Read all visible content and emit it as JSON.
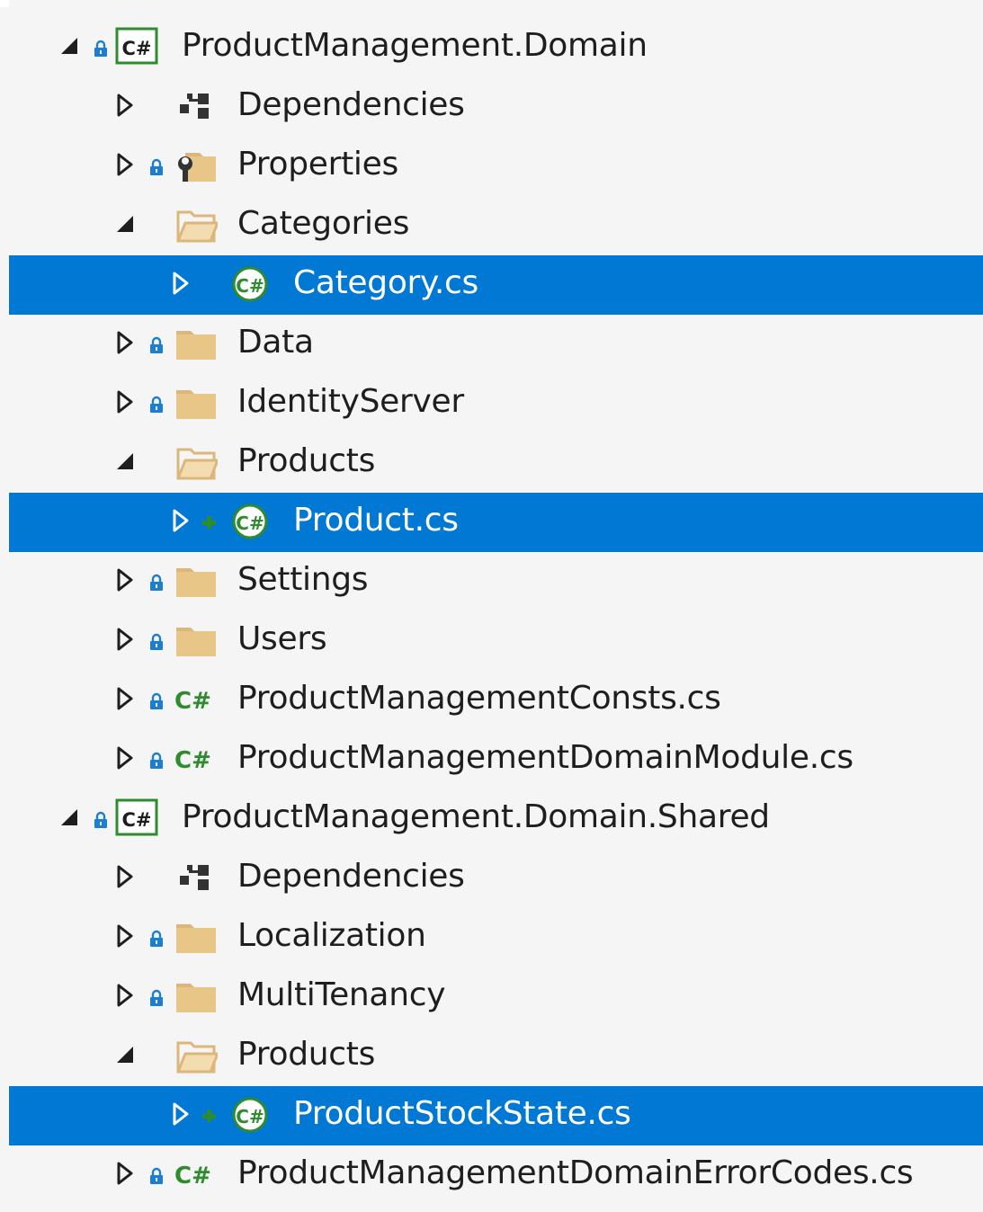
{
  "colors": {
    "background": "#f5f5f5",
    "selection": "#0078d4",
    "lock": "#1a7fd4",
    "csharp_green": "#2e8b2e",
    "folder": "#dcb67a"
  },
  "tree": [
    {
      "label": "ProductManagement.Domain",
      "level": 0,
      "expander": "expanded",
      "lock": true,
      "icon": "csharp-project-icon"
    },
    {
      "label": "Dependencies",
      "level": 1,
      "expander": "collapsed",
      "lock": false,
      "icon": "dependencies-icon"
    },
    {
      "label": "Properties",
      "level": 1,
      "expander": "collapsed",
      "lock": true,
      "icon": "properties-folder-icon"
    },
    {
      "label": "Categories",
      "level": 1,
      "expander": "expanded",
      "lock": false,
      "icon": "open-folder-icon"
    },
    {
      "label": "Category.cs",
      "level": 2,
      "expander": "collapsed",
      "lock": false,
      "plus": false,
      "icon": "csharp-class-icon",
      "selected": true
    },
    {
      "label": "Data",
      "level": 1,
      "expander": "collapsed",
      "lock": true,
      "icon": "folder-icon"
    },
    {
      "label": "IdentityServer",
      "level": 1,
      "expander": "collapsed",
      "lock": true,
      "icon": "folder-icon"
    },
    {
      "label": "Products",
      "level": 1,
      "expander": "expanded",
      "lock": false,
      "icon": "open-folder-icon"
    },
    {
      "label": "Product.cs",
      "level": 2,
      "expander": "collapsed",
      "lock": false,
      "plus": true,
      "icon": "csharp-class-icon",
      "selected": true
    },
    {
      "label": "Settings",
      "level": 1,
      "expander": "collapsed",
      "lock": true,
      "icon": "folder-icon"
    },
    {
      "label": "Users",
      "level": 1,
      "expander": "collapsed",
      "lock": true,
      "icon": "folder-icon"
    },
    {
      "label": "ProductManagementConsts.cs",
      "level": 1,
      "expander": "collapsed",
      "lock": true,
      "icon": "csharp-file-icon"
    },
    {
      "label": "ProductManagementDomainModule.cs",
      "level": 1,
      "expander": "collapsed",
      "lock": true,
      "icon": "csharp-file-icon"
    },
    {
      "label": "ProductManagement.Domain.Shared",
      "level": 0,
      "expander": "expanded",
      "lock": true,
      "icon": "csharp-project-icon"
    },
    {
      "label": "Dependencies",
      "level": 1,
      "expander": "collapsed",
      "lock": false,
      "icon": "dependencies-icon"
    },
    {
      "label": "Localization",
      "level": 1,
      "expander": "collapsed",
      "lock": true,
      "icon": "folder-icon"
    },
    {
      "label": "MultiTenancy",
      "level": 1,
      "expander": "collapsed",
      "lock": true,
      "icon": "folder-icon"
    },
    {
      "label": "Products",
      "level": 1,
      "expander": "expanded",
      "lock": false,
      "icon": "open-folder-icon"
    },
    {
      "label": "ProductStockState.cs",
      "level": 2,
      "expander": "collapsed",
      "lock": false,
      "plus": true,
      "icon": "csharp-class-icon",
      "selected": true
    },
    {
      "label": "ProductManagementDomainErrorCodes.cs",
      "level": 1,
      "expander": "collapsed",
      "lock": true,
      "icon": "csharp-file-icon"
    }
  ]
}
